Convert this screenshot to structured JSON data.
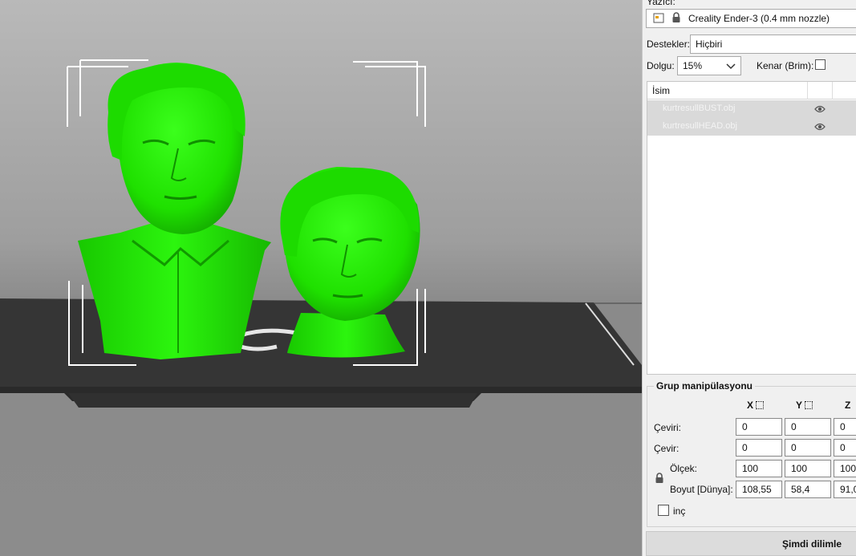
{
  "panel": {
    "printer_label": "Yazıcı:",
    "printer_value": "Creality Ender-3 (0.4 mm nozzle)",
    "support_label": "Destekler:",
    "support_value": "Hiçbiri",
    "infill_label": "Dolgu:",
    "infill_value": "15%",
    "brim_label": "Kenar (Brim):"
  },
  "object_list": {
    "header": "İsim",
    "items": [
      {
        "name": "kurtresullBUST.obj",
        "icon": "eye-icon"
      },
      {
        "name": "kurtresullHEAD.obj",
        "icon": "eye-icon"
      }
    ]
  },
  "group": {
    "title": "Grup manipülasyonu",
    "axes": [
      "X",
      "Y",
      "Z"
    ],
    "rows": [
      {
        "label": "Çeviri:",
        "values": [
          "0",
          "0",
          "0"
        ]
      },
      {
        "label": "Çevir:",
        "values": [
          "0",
          "0",
          "0"
        ]
      },
      {
        "label": "Ölçek:",
        "values": [
          "100",
          "100",
          "100"
        ]
      },
      {
        "label": "Boyut [Dünya]:",
        "values": [
          "108,55",
          "58,4",
          "91,0"
        ]
      }
    ],
    "inch_label": "inç"
  },
  "slice_button": "Şimdi dilimle",
  "colors": {
    "model": "#1fe000",
    "bed": "#3a3a3a",
    "accent_selection": "#ffffff"
  }
}
